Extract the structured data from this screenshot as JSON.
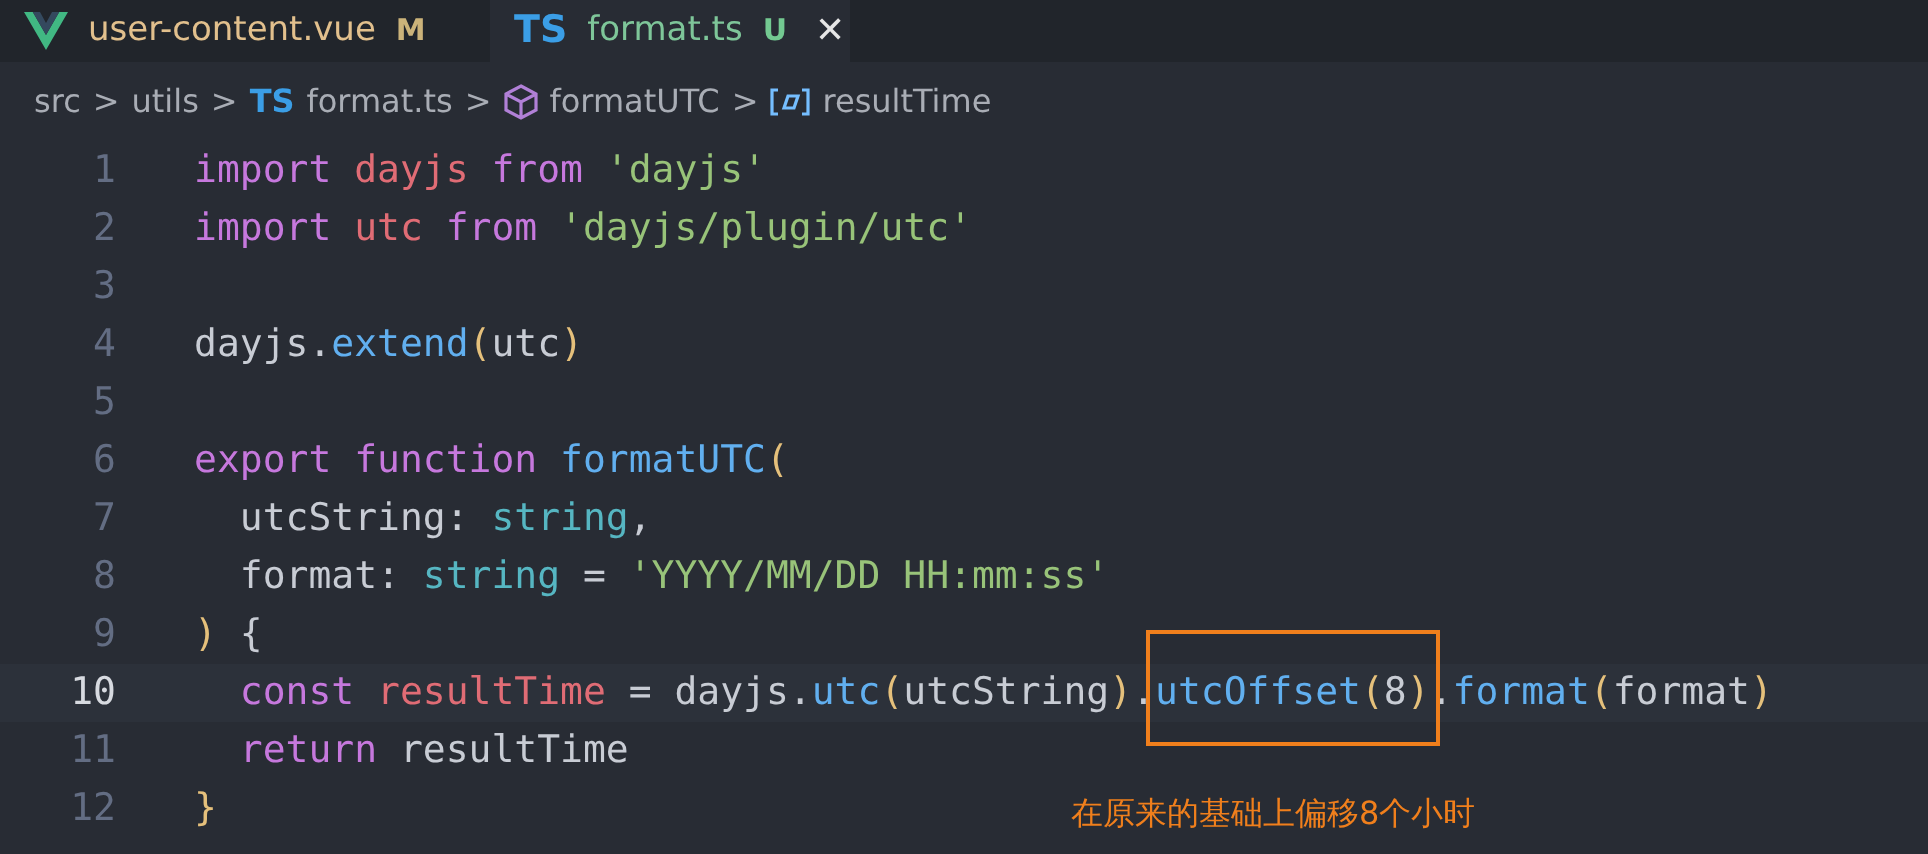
{
  "tabs": [
    {
      "label": "user-content.vue",
      "status": "M",
      "selected": false
    },
    {
      "icon_text": "TS",
      "label": "format.ts",
      "status": "U",
      "selected": true,
      "close": "✕"
    }
  ],
  "breadcrumbs": [
    {
      "kind": "folder",
      "label": "src"
    },
    {
      "kind": "folder",
      "label": "utils"
    },
    {
      "kind": "ts",
      "icon_text": "TS",
      "label": "format.ts"
    },
    {
      "kind": "function",
      "label": "formatUTC"
    },
    {
      "kind": "variable",
      "label": "resultTime"
    }
  ],
  "breadcrumb_separator": ">",
  "lines": [
    {
      "number": "1",
      "active": false,
      "tokens": [
        {
          "kind": "keyword",
          "text": "import "
        },
        {
          "kind": "variable",
          "text": "dayjs "
        },
        {
          "kind": "keyword",
          "text": "from "
        },
        {
          "kind": "string",
          "text": "'dayjs'"
        }
      ]
    },
    {
      "number": "2",
      "active": false,
      "tokens": [
        {
          "kind": "keyword",
          "text": "import "
        },
        {
          "kind": "variable",
          "text": "utc "
        },
        {
          "kind": "keyword",
          "text": "from "
        },
        {
          "kind": "string",
          "text": "'dayjs/plugin/utc'"
        }
      ]
    },
    {
      "number": "3",
      "active": false
    },
    {
      "number": "4",
      "active": false,
      "tokens": [
        {
          "kind": "plain",
          "text": "dayjs."
        },
        {
          "kind": "function",
          "text": "extend"
        },
        {
          "kind": "bracket",
          "text": "("
        },
        {
          "kind": "plain",
          "text": "utc"
        },
        {
          "kind": "bracket",
          "text": ")"
        }
      ]
    },
    {
      "number": "5",
      "active": false
    },
    {
      "number": "6",
      "active": false,
      "tokens": [
        {
          "kind": "keyword",
          "text": "export "
        },
        {
          "kind": "keyword",
          "text": "function "
        },
        {
          "kind": "function",
          "text": "formatUTC"
        },
        {
          "kind": "bracket",
          "text": "("
        }
      ]
    },
    {
      "number": "7",
      "active": false,
      "tokens": [
        {
          "kind": "plain",
          "text": "  utcString: "
        },
        {
          "kind": "type",
          "text": "string"
        },
        {
          "kind": "plain",
          "text": ","
        }
      ]
    },
    {
      "number": "8",
      "active": false,
      "tokens": [
        {
          "kind": "plain",
          "text": "  format: "
        },
        {
          "kind": "type",
          "text": "string"
        },
        {
          "kind": "plain",
          "text": " = "
        },
        {
          "kind": "string",
          "text": "'YYYY/MM/DD HH:mm:ss'"
        }
      ]
    },
    {
      "number": "9",
      "active": false,
      "tokens": [
        {
          "kind": "bracket",
          "text": ")"
        },
        {
          "kind": "plain",
          "text": " {"
        }
      ]
    },
    {
      "number": "10",
      "active": true,
      "tokens": [
        {
          "kind": "keyword",
          "text": "  const "
        },
        {
          "kind": "variable",
          "text": "resultTime"
        },
        {
          "kind": "plain",
          "text": " = dayjs."
        },
        {
          "kind": "function",
          "text": "utc"
        },
        {
          "kind": "bracket",
          "text": "("
        },
        {
          "kind": "plain",
          "text": "utcString"
        },
        {
          "kind": "bracket",
          "text": ")"
        },
        {
          "kind": "plain",
          "text": "."
        },
        {
          "kind": "function",
          "text": "utcOffset",
          "boxed": true
        },
        {
          "kind": "bracket",
          "text": "(",
          "boxed": true
        },
        {
          "kind": "plain",
          "text": "8",
          "boxed": true
        },
        {
          "kind": "bracket",
          "text": ")",
          "boxed": true
        },
        {
          "kind": "plain",
          "text": "."
        },
        {
          "kind": "function",
          "text": "format"
        },
        {
          "kind": "bracket",
          "text": "("
        },
        {
          "kind": "plain",
          "text": "format"
        },
        {
          "kind": "bracket",
          "text": ")"
        }
      ],
      "annotation": "在原来的基础上偏移8个小时"
    },
    {
      "number": "11",
      "active": false,
      "tokens": [
        {
          "kind": "keyword",
          "text": "  return "
        },
        {
          "kind": "plain",
          "text": "resultTime"
        }
      ]
    },
    {
      "number": "12",
      "active": false,
      "tokens": [
        {
          "kind": "bracket",
          "text": "}"
        }
      ]
    }
  ]
}
